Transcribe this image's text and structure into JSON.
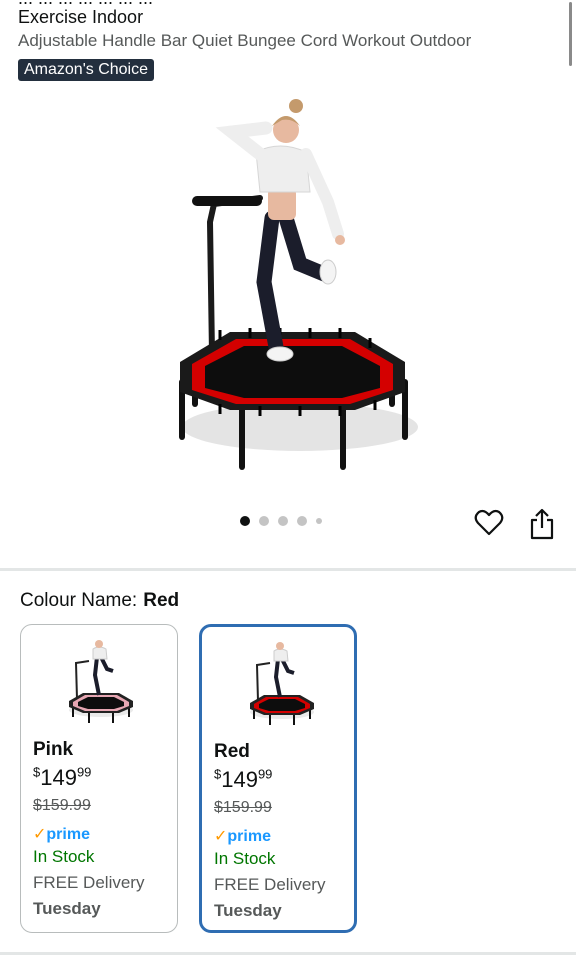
{
  "product": {
    "title_partial": "... ... ... ... ... ... ...",
    "title_line": "Exercise Indoor",
    "subtitle": "Adjustable Handle Bar Quiet Bungee Cord Workout Outdoor",
    "badge": "Amazon's Choice"
  },
  "gallery": {
    "image_count": 5,
    "active_index": 0
  },
  "actions": {
    "wishlist_icon": "heart-outline-icon",
    "share_icon": "share-icon"
  },
  "colour": {
    "label": "Colour Name:",
    "selected": "Red"
  },
  "variants": [
    {
      "name": "Pink",
      "currency": "$",
      "price_whole": "149",
      "price_fraction": "99",
      "original_price": "$159.99",
      "prime_check": "✓",
      "prime_label": "prime",
      "stock": "In Stock",
      "delivery": "FREE Delivery",
      "day": "Tuesday",
      "selected": false
    },
    {
      "name": "Red",
      "currency": "$",
      "price_whole": "149",
      "price_fraction": "99",
      "original_price": "$159.99",
      "prime_check": "✓",
      "prime_label": "prime",
      "stock": "In Stock",
      "delivery": "FREE Delivery",
      "day": "Tuesday",
      "selected": true
    }
  ],
  "colors": {
    "accent_blue": "#2f6db2",
    "prime_blue": "#1a98ff",
    "prime_orange": "#ff9900",
    "stock_green": "#007600",
    "badge_bg": "#232f3e"
  }
}
